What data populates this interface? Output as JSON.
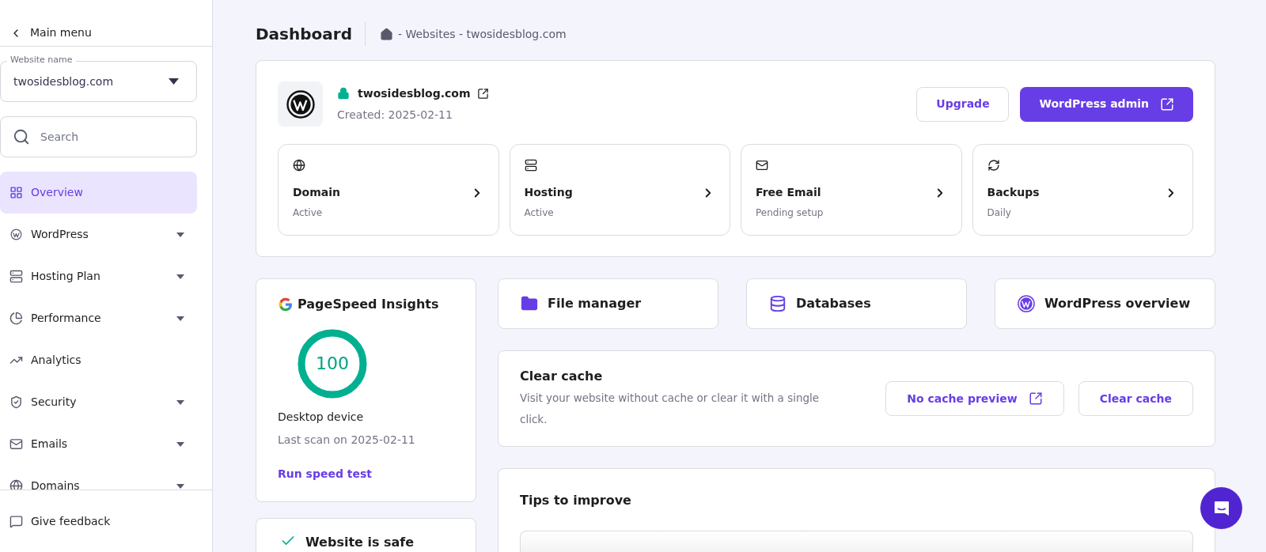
{
  "sidebar": {
    "back": "Main menu",
    "website_select": {
      "label": "Website name",
      "value": "twosidesblog.com"
    },
    "search": {
      "placeholder": "Search"
    },
    "items": [
      {
        "label": "Overview",
        "selected": true,
        "has_submenu": false
      },
      {
        "label": "WordPress",
        "selected": false,
        "has_submenu": true
      },
      {
        "label": "Hosting Plan",
        "selected": false,
        "has_submenu": true
      },
      {
        "label": "Performance",
        "selected": false,
        "has_submenu": true
      },
      {
        "label": "Analytics",
        "selected": false,
        "has_submenu": false
      },
      {
        "label": "Security",
        "selected": false,
        "has_submenu": true
      },
      {
        "label": "Emails",
        "selected": false,
        "has_submenu": true
      },
      {
        "label": "Domains",
        "selected": false,
        "has_submenu": true
      }
    ],
    "feedback": "Give feedback"
  },
  "header": {
    "title": "Dashboard",
    "breadcrumb": "- Websites - twosidesblog.com"
  },
  "site_card": {
    "domain": "twosidesblog.com",
    "created": "Created: 2025-02-11",
    "buttons": [
      {
        "label": "Upgrade",
        "kind": "secondary"
      },
      {
        "label": "WordPress admin",
        "kind": "primary"
      }
    ],
    "services": [
      {
        "title": "Domain",
        "status": "Active"
      },
      {
        "title": "Hosting",
        "status": "Active"
      },
      {
        "title": "Free Email",
        "status": "Pending setup"
      },
      {
        "title": "Backups",
        "status": "Daily"
      }
    ]
  },
  "pagespeed": {
    "title": "PageSpeed Insights",
    "score": "100",
    "level": 1,
    "device": "Desktop device",
    "last_scan": "Last scan on 2025-02-11",
    "link": "Run speed test"
  },
  "shortcuts": [
    "File manager",
    "Databases",
    "WordPress overview"
  ],
  "clear_cache": {
    "title": "Clear cache",
    "description": "Visit your website without cache or clear it with a single click.",
    "buttons": [
      "No cache preview",
      "Clear cache"
    ]
  },
  "tips": {
    "title": "Tips to improve"
  },
  "security": {
    "title": "Website is safe"
  }
}
